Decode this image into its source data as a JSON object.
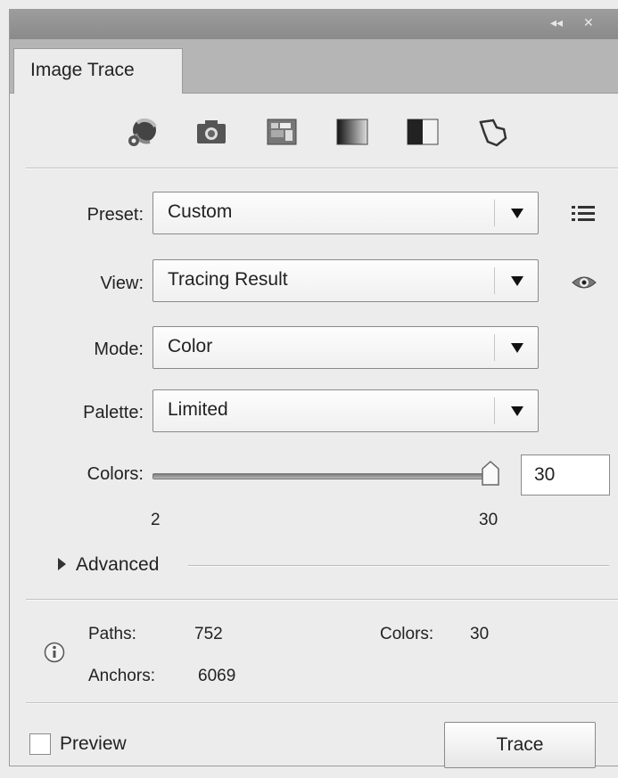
{
  "panel": {
    "tab_title": "Image Trace",
    "collapse_glyph": "◂◂",
    "close_glyph": "✕"
  },
  "presets_toolbar": [
    {
      "name": "auto-color-icon"
    },
    {
      "name": "high-color-icon"
    },
    {
      "name": "low-color-icon"
    },
    {
      "name": "grayscale-icon"
    },
    {
      "name": "black-and-white-icon"
    },
    {
      "name": "outline-icon"
    }
  ],
  "preset": {
    "label": "Preset:",
    "value": "Custom"
  },
  "view": {
    "label": "View:",
    "value": "Tracing Result"
  },
  "mode": {
    "label": "Mode:",
    "value": "Color"
  },
  "palette": {
    "label": "Palette:",
    "value": "Limited"
  },
  "colors_slider": {
    "label": "Colors:",
    "min": "2",
    "max": "30",
    "value": "30",
    "level": 1.0
  },
  "advanced": {
    "label": "Advanced",
    "expanded": false
  },
  "stats": {
    "paths_label": "Paths:",
    "paths_value": "752",
    "colors_label": "Colors:",
    "colors_value": "30",
    "anchors_label": "Anchors:",
    "anchors_value": "6069"
  },
  "footer": {
    "preview_label": "Preview",
    "preview_checked": false,
    "trace_label": "Trace"
  }
}
